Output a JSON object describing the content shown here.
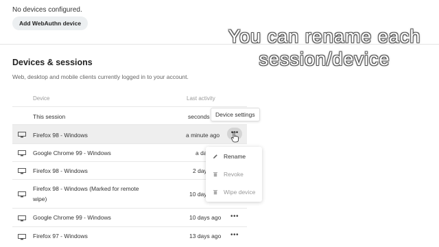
{
  "webauthn": {
    "status": "No devices configured.",
    "add_button": "Add WebAuthn device"
  },
  "sessions": {
    "title": "Devices & sessions",
    "description": "Web, desktop and mobile clients currently logged in to your account.",
    "columns": {
      "device": "Device",
      "last_activity": "Last activity"
    },
    "rows": [
      {
        "device": "This session",
        "activity": "seconds",
        "icon": "none"
      },
      {
        "device": "Firefox 98 - Windows",
        "activity": "a minute ago",
        "icon": "monitor-icon"
      },
      {
        "device": "Google Chrome 99 - Windows",
        "activity": "a da",
        "icon": "monitor-icon"
      },
      {
        "device": "Firefox 98 - Windows",
        "activity": "2 day",
        "icon": "monitor-icon"
      },
      {
        "device": "Firefox 98 - Windows (Marked for remote",
        "device_line2": "wipe)",
        "activity": "10 day",
        "icon": "monitor-icon"
      },
      {
        "device": "Google Chrome 99 - Windows",
        "activity": "10 days ago",
        "icon": "monitor-icon"
      },
      {
        "device": "Firefox 97 - Windows",
        "activity": "13 days ago",
        "icon": "monitor-icon"
      }
    ],
    "more_glyph": "•••"
  },
  "tooltip": {
    "text": "Device settings"
  },
  "menu": {
    "items": [
      {
        "label": "Rename",
        "icon": "pencil-icon"
      },
      {
        "label": "Revoke",
        "icon": "trash-icon"
      },
      {
        "label": "Wipe device",
        "icon": "trash-icon"
      }
    ]
  },
  "overlay": {
    "line1": "You can rename each",
    "line2": "session/device"
  },
  "colors": {
    "highlight_row": "#eeeeee",
    "muted_text": "#9a9a9a",
    "disabled_text": "#999999"
  }
}
